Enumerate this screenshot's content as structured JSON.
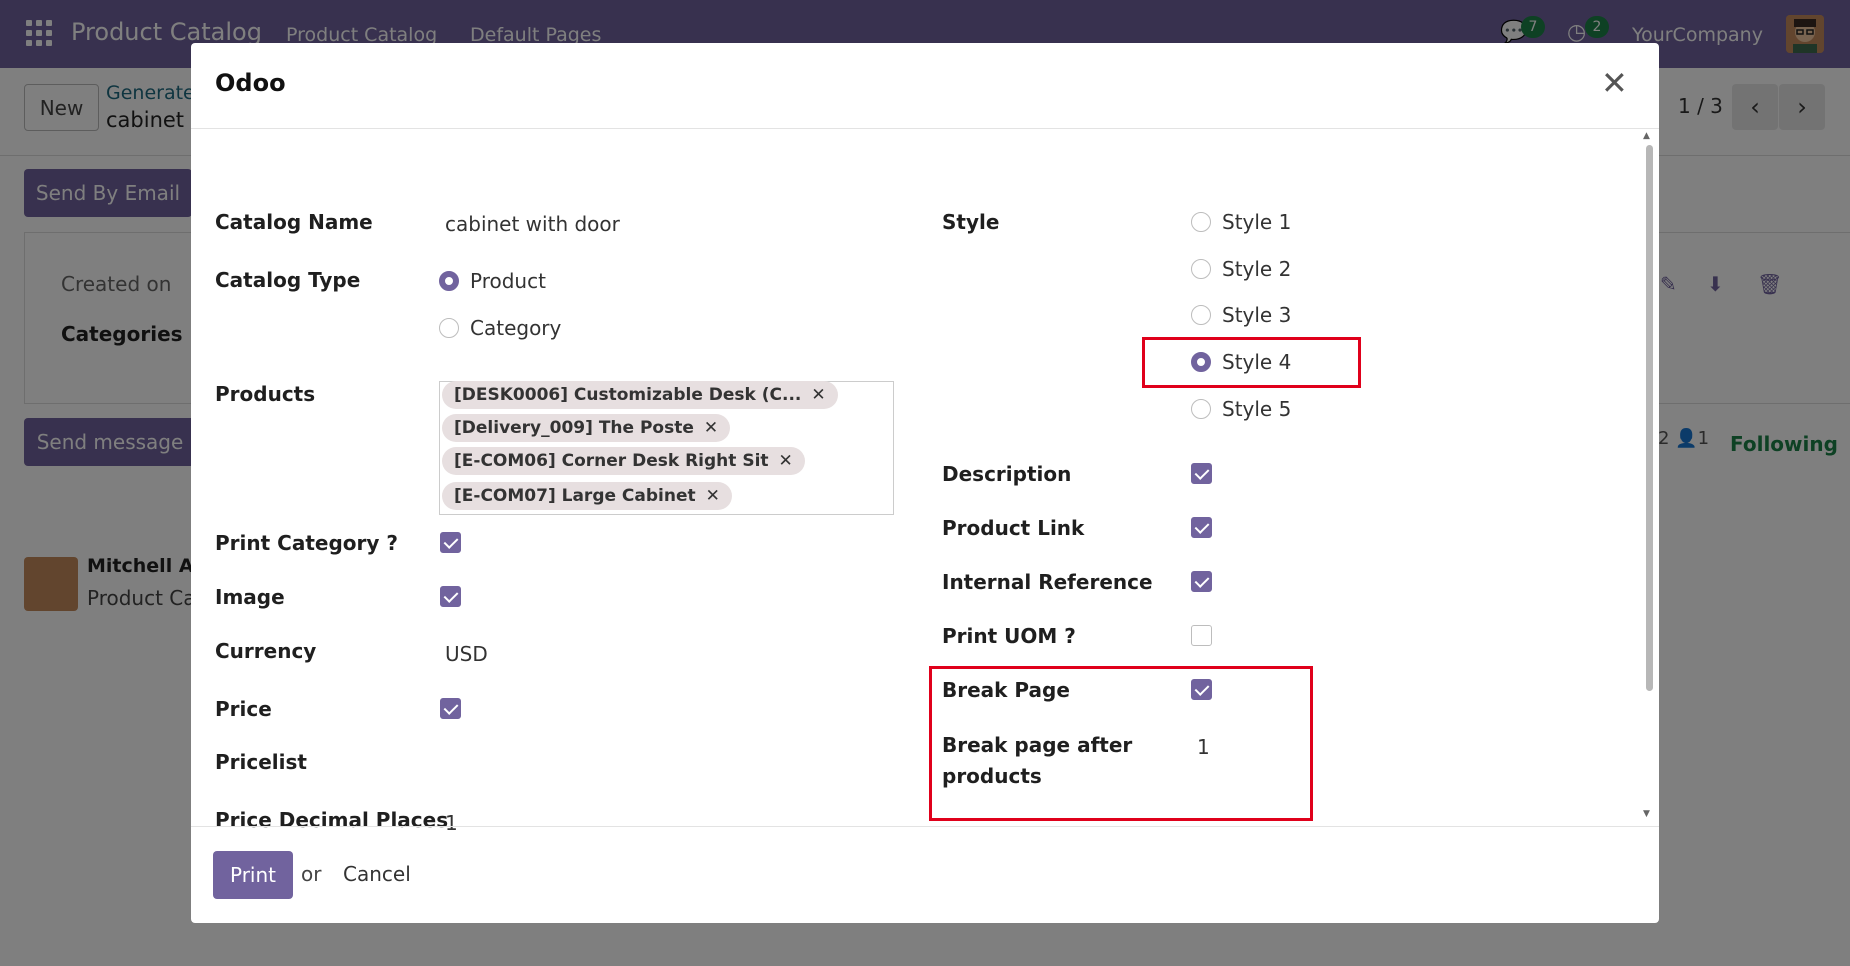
{
  "navbar": {
    "brand": "Product Catalog",
    "menu": [
      "Product Catalog",
      "Default Pages"
    ],
    "messages_count": "7",
    "activities_count": "2",
    "company": "YourCompany"
  },
  "background": {
    "new_label": "New",
    "breadcrumb_parent": "Generate",
    "breadcrumb_record": "cabinet w",
    "pager": "1 / 3",
    "send_email_label": "Send By Email",
    "created_on_label": "Created on",
    "categories_label": "Categories",
    "send_message_label": "Send message",
    "author_name": "Mitchell Ad",
    "author_sub": "Product Ca",
    "followers_count": "2",
    "follower_count_2": "1",
    "following_label": "Following"
  },
  "modal": {
    "title": "Odoo",
    "left": {
      "catalog_name_label": "Catalog Name",
      "catalog_name_value": "cabinet with door",
      "catalog_type_label": "Catalog Type",
      "catalog_type_options": [
        "Product",
        "Category"
      ],
      "catalog_type_selected": "Product",
      "products_label": "Products",
      "products": [
        "[DESK0006] Customizable Desk (C...",
        "[Delivery_009] The Poste",
        "[E-COM06] Corner Desk Right Sit",
        "[E-COM07] Large Cabinet"
      ],
      "print_category_label": "Print Category ?",
      "print_category_checked": true,
      "image_label": "Image",
      "image_checked": true,
      "currency_label": "Currency",
      "currency_value": "USD",
      "price_label": "Price",
      "price_checked": true,
      "pricelist_label": "Pricelist",
      "pricelist_value": "",
      "decimal_label": "Price Decimal Places",
      "decimal_value": "1"
    },
    "right": {
      "style_label": "Style",
      "style_options": [
        "Style 1",
        "Style 2",
        "Style 3",
        "Style 4",
        "Style 5"
      ],
      "style_selected": "Style 4",
      "description_label": "Description",
      "description_checked": true,
      "product_link_label": "Product Link",
      "product_link_checked": true,
      "internal_ref_label": "Internal Reference",
      "internal_ref_checked": true,
      "print_uom_label": "Print UOM ?",
      "print_uom_checked": false,
      "break_page_label": "Break Page",
      "break_page_checked": true,
      "break_after_label_1": "Break page after",
      "break_after_label_2": "products",
      "break_after_value": "1"
    },
    "footer": {
      "print_label": "Print",
      "or_label": "or",
      "cancel_label": "Cancel"
    }
  },
  "colors": {
    "primary": "#71639e",
    "highlight": "#e0001b",
    "badge": "#1d8348"
  }
}
